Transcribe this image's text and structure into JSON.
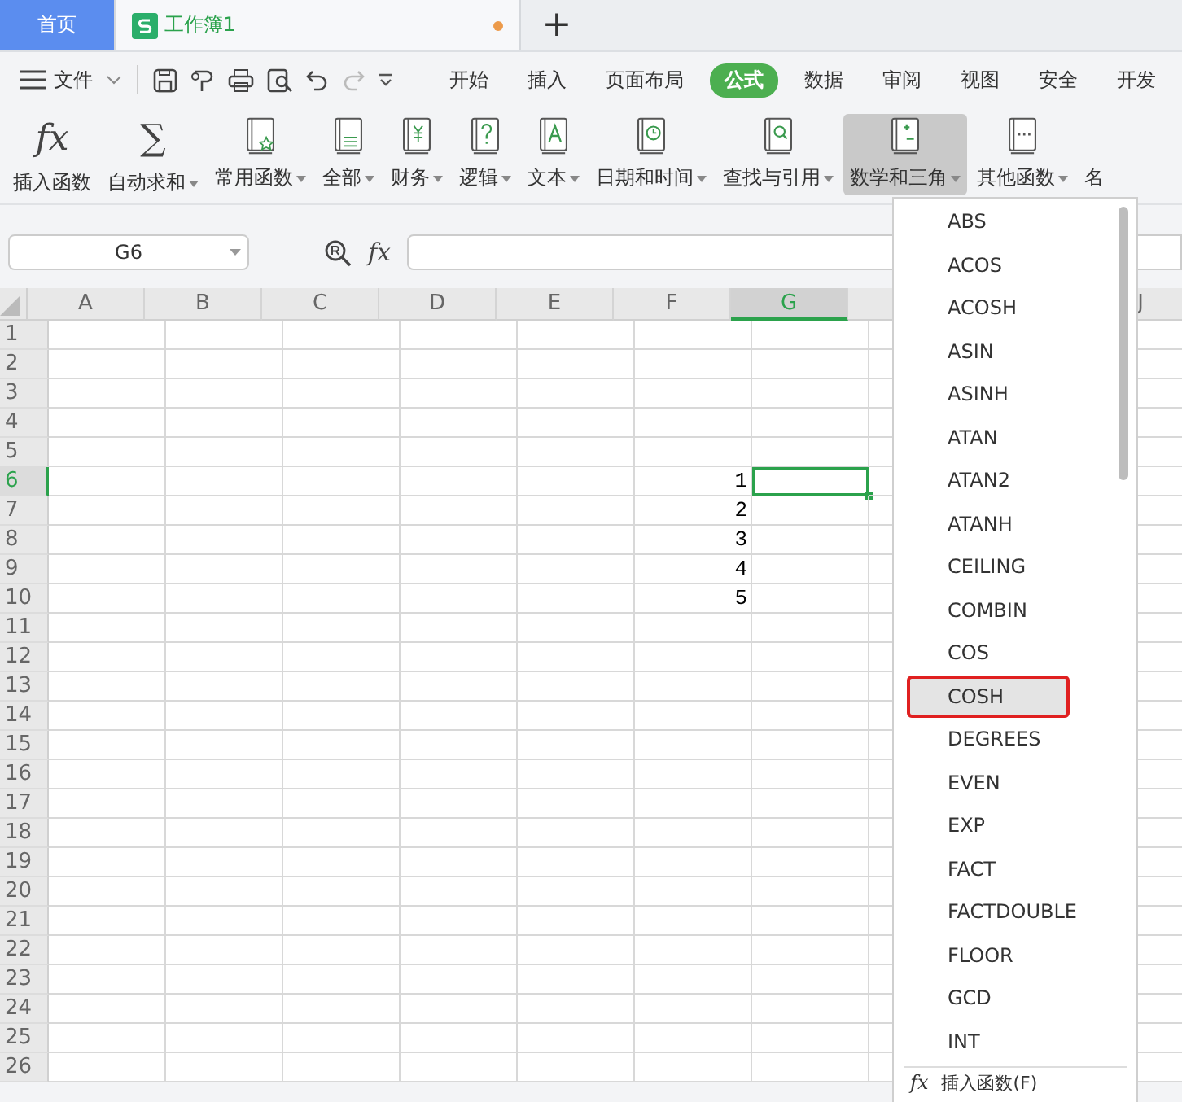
{
  "tabs": [
    {
      "label": "首页",
      "kind": "home",
      "selected": false
    },
    {
      "label": "工作簿1",
      "kind": "doc",
      "selected": true,
      "unsaved": true
    }
  ],
  "new_tab": "+",
  "menu": {
    "file": "文件",
    "tabs": [
      {
        "label": "开始",
        "selected": false
      },
      {
        "label": "插入",
        "selected": false
      },
      {
        "label": "页面布局",
        "selected": false
      },
      {
        "label": "公式",
        "selected": true
      },
      {
        "label": "数据",
        "selected": false
      },
      {
        "label": "审阅",
        "selected": false
      },
      {
        "label": "视图",
        "selected": false
      },
      {
        "label": "安全",
        "selected": false
      },
      {
        "label": "开发",
        "selected": false
      }
    ]
  },
  "ribbon": [
    {
      "label": "插入函数",
      "glyph": "fx",
      "dropdown": false,
      "selected": false
    },
    {
      "label": "自动求和",
      "glyph": "∑",
      "dropdown": true,
      "selected": false
    },
    {
      "label": "常用函数",
      "kind": "star",
      "dropdown": true,
      "selected": false
    },
    {
      "label": "全部",
      "kind": "lines",
      "dropdown": true,
      "selected": false
    },
    {
      "label": "财务",
      "kind": "money",
      "dropdown": true,
      "selected": false
    },
    {
      "label": "逻辑",
      "kind": "question",
      "dropdown": true,
      "selected": false
    },
    {
      "label": "文本",
      "kind": "letter",
      "dropdown": true,
      "selected": false
    },
    {
      "label": "日期和时间",
      "kind": "clock",
      "dropdown": true,
      "selected": false
    },
    {
      "label": "查找与引用",
      "kind": "magnifier",
      "dropdown": true,
      "selected": false
    },
    {
      "label": "数学和三角",
      "kind": "plusminus",
      "dropdown": true,
      "selected": true
    },
    {
      "label": "其他函数",
      "kind": "dots",
      "dropdown": true,
      "selected": false
    },
    {
      "label": "名",
      "kind": "plain",
      "dropdown": false,
      "selected": false
    }
  ],
  "name_box": "G6",
  "formula_glyph": "fx",
  "columns": [
    {
      "label": "A",
      "selected": false
    },
    {
      "label": "B",
      "selected": false
    },
    {
      "label": "C",
      "selected": false
    },
    {
      "label": "D",
      "selected": false
    },
    {
      "label": "E",
      "selected": false
    },
    {
      "label": "F",
      "selected": false
    },
    {
      "label": "G",
      "selected": true
    }
  ],
  "far_column": {
    "label": "J"
  },
  "rows": [
    {
      "label": "1",
      "selected": false
    },
    {
      "label": "2",
      "selected": false
    },
    {
      "label": "3",
      "selected": false
    },
    {
      "label": "4",
      "selected": false
    },
    {
      "label": "5",
      "selected": false
    },
    {
      "label": "6",
      "selected": true,
      "F": "1"
    },
    {
      "label": "7",
      "selected": false,
      "F": "2"
    },
    {
      "label": "8",
      "selected": false,
      "F": "3"
    },
    {
      "label": "9",
      "selected": false,
      "F": "4"
    },
    {
      "label": "10",
      "selected": false,
      "F": "5"
    },
    {
      "label": "11",
      "selected": false
    },
    {
      "label": "12",
      "selected": false
    },
    {
      "label": "13",
      "selected": false
    },
    {
      "label": "14",
      "selected": false
    },
    {
      "label": "15",
      "selected": false
    },
    {
      "label": "16",
      "selected": false
    },
    {
      "label": "17",
      "selected": false
    },
    {
      "label": "18",
      "selected": false
    },
    {
      "label": "19",
      "selected": false
    },
    {
      "label": "20",
      "selected": false
    },
    {
      "label": "21",
      "selected": false
    },
    {
      "label": "22",
      "selected": false
    },
    {
      "label": "23",
      "selected": false
    },
    {
      "label": "24",
      "selected": false
    },
    {
      "label": "25",
      "selected": false
    },
    {
      "label": "26",
      "selected": false
    }
  ],
  "function_menu": {
    "items": [
      {
        "label": "ABS",
        "selected": false,
        "annotated": false
      },
      {
        "label": "ACOS",
        "selected": false,
        "annotated": false
      },
      {
        "label": "ACOSH",
        "selected": false,
        "annotated": false
      },
      {
        "label": "ASIN",
        "selected": false,
        "annotated": false
      },
      {
        "label": "ASINH",
        "selected": false,
        "annotated": false
      },
      {
        "label": "ATAN",
        "selected": false,
        "annotated": false
      },
      {
        "label": "ATAN2",
        "selected": false,
        "annotated": false
      },
      {
        "label": "ATANH",
        "selected": false,
        "annotated": false
      },
      {
        "label": "CEILING",
        "selected": false,
        "annotated": false
      },
      {
        "label": "COMBIN",
        "selected": false,
        "annotated": false
      },
      {
        "label": "COS",
        "selected": false,
        "annotated": false
      },
      {
        "label": "COSH",
        "selected": true,
        "annotated": true
      },
      {
        "label": "DEGREES",
        "selected": false,
        "annotated": false
      },
      {
        "label": "EVEN",
        "selected": false,
        "annotated": false
      },
      {
        "label": "EXP",
        "selected": false,
        "annotated": false
      },
      {
        "label": "FACT",
        "selected": false,
        "annotated": false
      },
      {
        "label": "FACTDOUBLE",
        "selected": false,
        "annotated": false
      },
      {
        "label": "FLOOR",
        "selected": false,
        "annotated": false
      },
      {
        "label": "GCD",
        "selected": false,
        "annotated": false
      },
      {
        "label": "INT",
        "selected": false,
        "annotated": false
      }
    ],
    "footer": {
      "glyph": "fx",
      "label": "插入函数(F)"
    }
  }
}
